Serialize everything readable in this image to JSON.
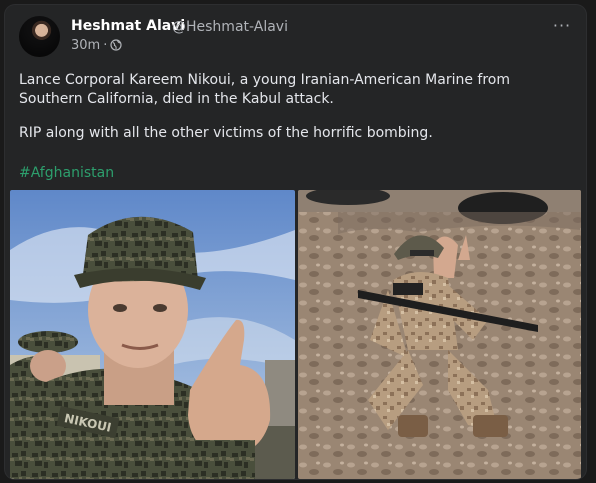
{
  "post": {
    "author_name": "Heshmat Alavi",
    "author_handle": "@Heshmat-Alavi",
    "timestamp": "30m",
    "separator": "·",
    "visibility_icon": "globe-icon",
    "more_icon": "more-options-icon",
    "more_label": "···",
    "paragraph1": "Lance Corporal Kareem Nikoui, a young Iranian-American Marine from Southern California, died in the Kabul attack.",
    "paragraph2": "RIP along with all the other victims of the horrific bombing.",
    "hashtag": "#Afghanistan",
    "images": [
      {
        "name_tape": "NIKOUI"
      }
    ]
  },
  "colors": {
    "background": "#1a1a1a",
    "card": "#242526",
    "text": "#e4e6eb",
    "muted": "#b0b3b8",
    "hashtag": "#2d9f6d"
  }
}
